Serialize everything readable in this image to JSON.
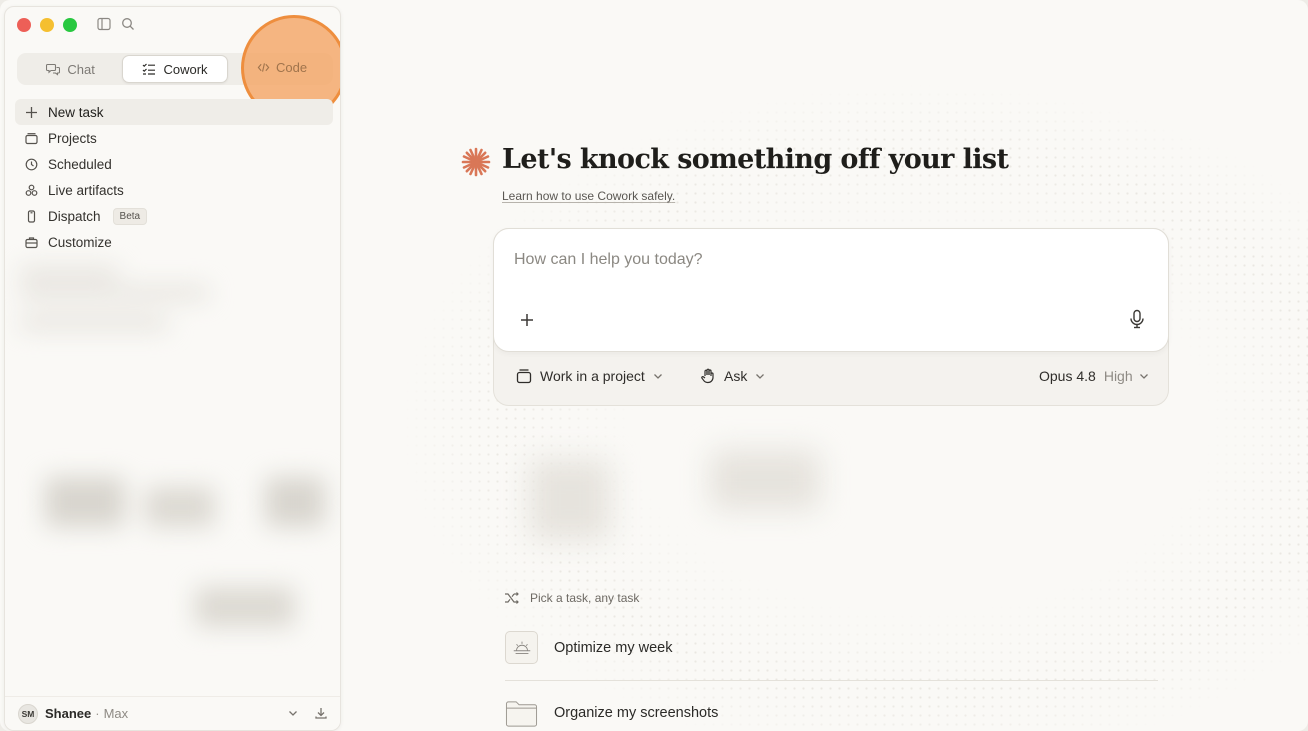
{
  "window": {
    "traffic_lights": [
      "close",
      "minimize",
      "zoom"
    ],
    "colors": {
      "close": "#ed5f57",
      "minimize": "#f5bf30",
      "zoom": "#28c840",
      "accent": "#d97757",
      "highlight": "#ee8e3e"
    }
  },
  "sidebar": {
    "toggle_icon": "sidebar-toggle-icon",
    "search_icon": "search-icon",
    "mode_tabs": [
      {
        "label": "Chat",
        "icon": "chat-bubbles-icon",
        "active": false
      },
      {
        "label": "Cowork",
        "icon": "checklist-icon",
        "active": true
      },
      {
        "label": "Code",
        "icon": "code-brackets-icon",
        "active": false
      }
    ],
    "nav": [
      {
        "label": "New task",
        "icon": "plus-icon"
      },
      {
        "label": "Projects",
        "icon": "folder-stack-icon"
      },
      {
        "label": "Scheduled",
        "icon": "clock-icon"
      },
      {
        "label": "Live artifacts",
        "icon": "artifacts-icon"
      },
      {
        "label": "Dispatch",
        "icon": "phone-icon",
        "badge": "Beta"
      },
      {
        "label": "Customize",
        "icon": "briefcase-icon"
      }
    ],
    "account": {
      "initials": "SM",
      "name": "Shanee",
      "separator": "·",
      "plan": "Max"
    }
  },
  "main": {
    "title": "Let's knock something off your list",
    "safety_link": "Learn how to use Cowork safely",
    "safety_link_suffix": ".",
    "composer": {
      "placeholder": "How can I help you today?",
      "project_button": "Work in a project",
      "mode_button": "Ask",
      "model": "Opus 4.8",
      "effort": "High"
    },
    "suggestions": {
      "header": "Pick a task, any task",
      "items": [
        {
          "label": "Optimize my week",
          "icon": "sunrise-icon"
        },
        {
          "label": "Organize my screenshots",
          "icon": "folder-icon"
        }
      ]
    }
  }
}
